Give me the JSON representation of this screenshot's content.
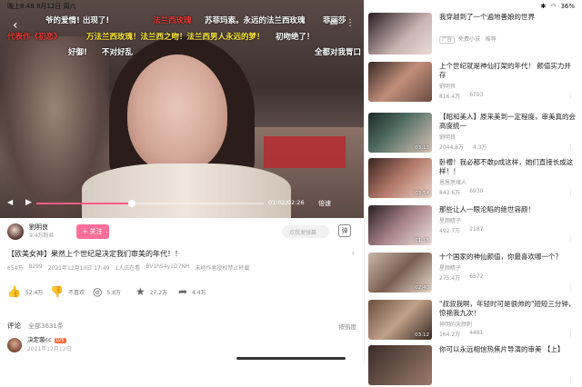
{
  "status": {
    "time_date": "晚上8:48  8月12日 周六",
    "battery": "36%"
  },
  "video": {
    "danmaku": [
      {
        "text": "爷的爱情! 出现了!",
        "color": "#ffffff"
      },
      {
        "text": "法兰西玫瑰",
        "color": "#e53935"
      },
      {
        "text": "苏菲玛索。永远的法兰西玫瑰",
        "color": "#ffffff"
      },
      {
        "text": "菲丽莎",
        "color": "#ffffff"
      },
      {
        "text": "代表作《初恋》",
        "color": "#e53935"
      },
      {
        "text": "万法兰西玫瑰！法兰西之吻！法兰西男人永远的梦！",
        "color": "#ffeb3b"
      },
      {
        "text": "初吻绝了！",
        "color": "#ffffff"
      },
      {
        "text": "好御!",
        "color": "#ffffff"
      },
      {
        "text": "不对好乱",
        "color": "#ffffff"
      },
      {
        "text": "全都对我胃口",
        "color": "#ffffff"
      },
      {
        "text": "全都对我胃口",
        "color": "#ffffff"
      }
    ],
    "time": "01:02/02:26",
    "speed": "倍速",
    "progress_fraction": 0.42
  },
  "uploader": {
    "name": "劉明良",
    "fans": "9.4万粉丝",
    "follow_label": "+ 关注",
    "danmu_placeholder": "点我发弹幕"
  },
  "video_info": {
    "title": "【欧美女神】果然上个世纪是决定我们审美的年代！！",
    "views": "654万",
    "danmaku_count": "8299",
    "date": "2021年12月10日 17:49",
    "online": "1人正在看",
    "bvid": "BV1hS4y1D7NH",
    "warning": "未经作者授权禁止转载"
  },
  "actions": [
    {
      "icon": "thumb-up-icon",
      "glyph": "👍",
      "label": "52.4万"
    },
    {
      "icon": "thumb-down-icon",
      "glyph": "👎",
      "label": "不喜欢"
    },
    {
      "icon": "coin-icon",
      "glyph": "◎",
      "label": "5.8万"
    },
    {
      "icon": "star-icon",
      "glyph": "★",
      "label": "27.2万"
    },
    {
      "icon": "share-icon",
      "glyph": "➦",
      "label": "4.4万"
    }
  ],
  "comments": {
    "label": "评论",
    "count": "全部3631条",
    "sort": "按热度",
    "first": {
      "user": "决定菌cc",
      "level": "LV5",
      "date": "2021年12月12日"
    }
  },
  "sidebar": {
    "ad": {
      "title": "我穿越到了一个遍地善娘的世界",
      "tag": "广告",
      "sub": "免费小说 · 推荐"
    },
    "recs": [
      {
        "title": "上个世纪就是神仙打架的年代！ 颜值实力并存",
        "up": "劉明良",
        "views": "816.4万",
        "danmaku": "6793",
        "duration": ""
      },
      {
        "title": "【昭和美人】原来美到一定程度，审美真的会高度统一",
        "up": "劉明良",
        "views": "2044.8万",
        "danmaku": "4.3万",
        "duration": "03:13"
      },
      {
        "title": "卧槽！我必都不敢p成这样，她们直接长成这样！！",
        "up": "恩恩思绪人",
        "views": "843.6万",
        "danmaku": "6930",
        "duration": "03:54"
      },
      {
        "title": "那些让人一眼沦陷的绝世容颜！",
        "up": "星颜睛子",
        "views": "492.7万",
        "danmaku": "2187",
        "duration": "01:18"
      },
      {
        "title": "十个国家的神仙颜值，你最喜欢哪一个？",
        "up": "星颜睛子",
        "views": "275.4万",
        "danmaku": "6572",
        "duration": "02:40"
      },
      {
        "title": "\"叔叔我啊，年轻时可是很帅的\"短短三分钟，惊艳我九次！",
        "up": "神明的天颜刺",
        "views": "164.2万",
        "danmaku": "4481",
        "duration": "03:12"
      },
      {
        "title": "你可以永远相信热焦片导演的审美 【上】",
        "up": "",
        "views": "",
        "danmaku": "",
        "duration": ""
      }
    ]
  }
}
